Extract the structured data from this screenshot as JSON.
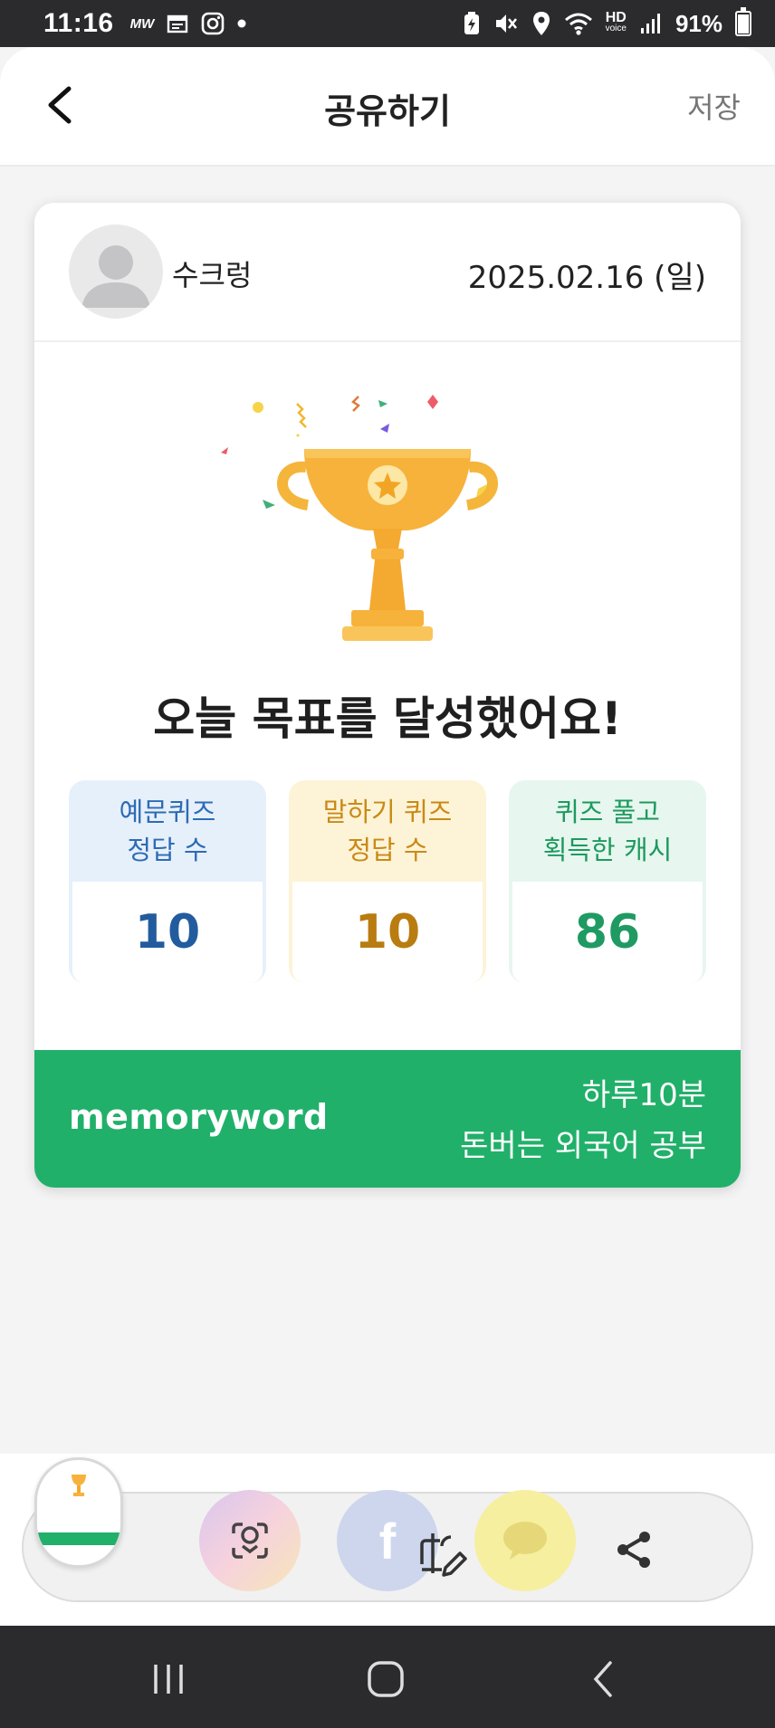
{
  "status_bar": {
    "time": "11:16",
    "battery": "91%",
    "left_icons": [
      "mw-icon",
      "calendar-icon",
      "instagram-icon",
      "dot-icon"
    ],
    "right_icons": [
      "battery-saver-icon",
      "mute-icon",
      "location-icon",
      "wifi-icon",
      "hd-voice-icon",
      "signal-icon",
      "battery-icon"
    ]
  },
  "header": {
    "title": "공유하기",
    "save_label": "저장"
  },
  "card": {
    "user_name": "수크렁",
    "date": "2025.02.16 (일)",
    "headline": "오늘 목표를 달성했어요!",
    "stats": [
      {
        "label_line1": "예문퀴즈",
        "label_line2": "정답 수",
        "value": "10",
        "color": "#235c9e"
      },
      {
        "label_line1": "말하기 퀴즈",
        "label_line2": "정답 수",
        "value": "10",
        "color": "#b97c10"
      },
      {
        "label_line1": "퀴즈 풀고",
        "label_line2": "획득한 캐시",
        "value": "86",
        "color": "#1f9a63"
      }
    ],
    "footer": {
      "brand": "memoryword",
      "slogan_line1": "하루10분",
      "slogan_line2": "돈버는 외국어 공부",
      "color": "#21b06a"
    }
  },
  "share_bar": {
    "items": [
      "screenshot-thumbnail",
      "google-lens-icon",
      "facebook-icon",
      "edit-icon",
      "kakaotalk-icon",
      "share-icon"
    ]
  },
  "nav": {
    "buttons": [
      "recents-icon",
      "home-icon",
      "back-icon"
    ]
  }
}
